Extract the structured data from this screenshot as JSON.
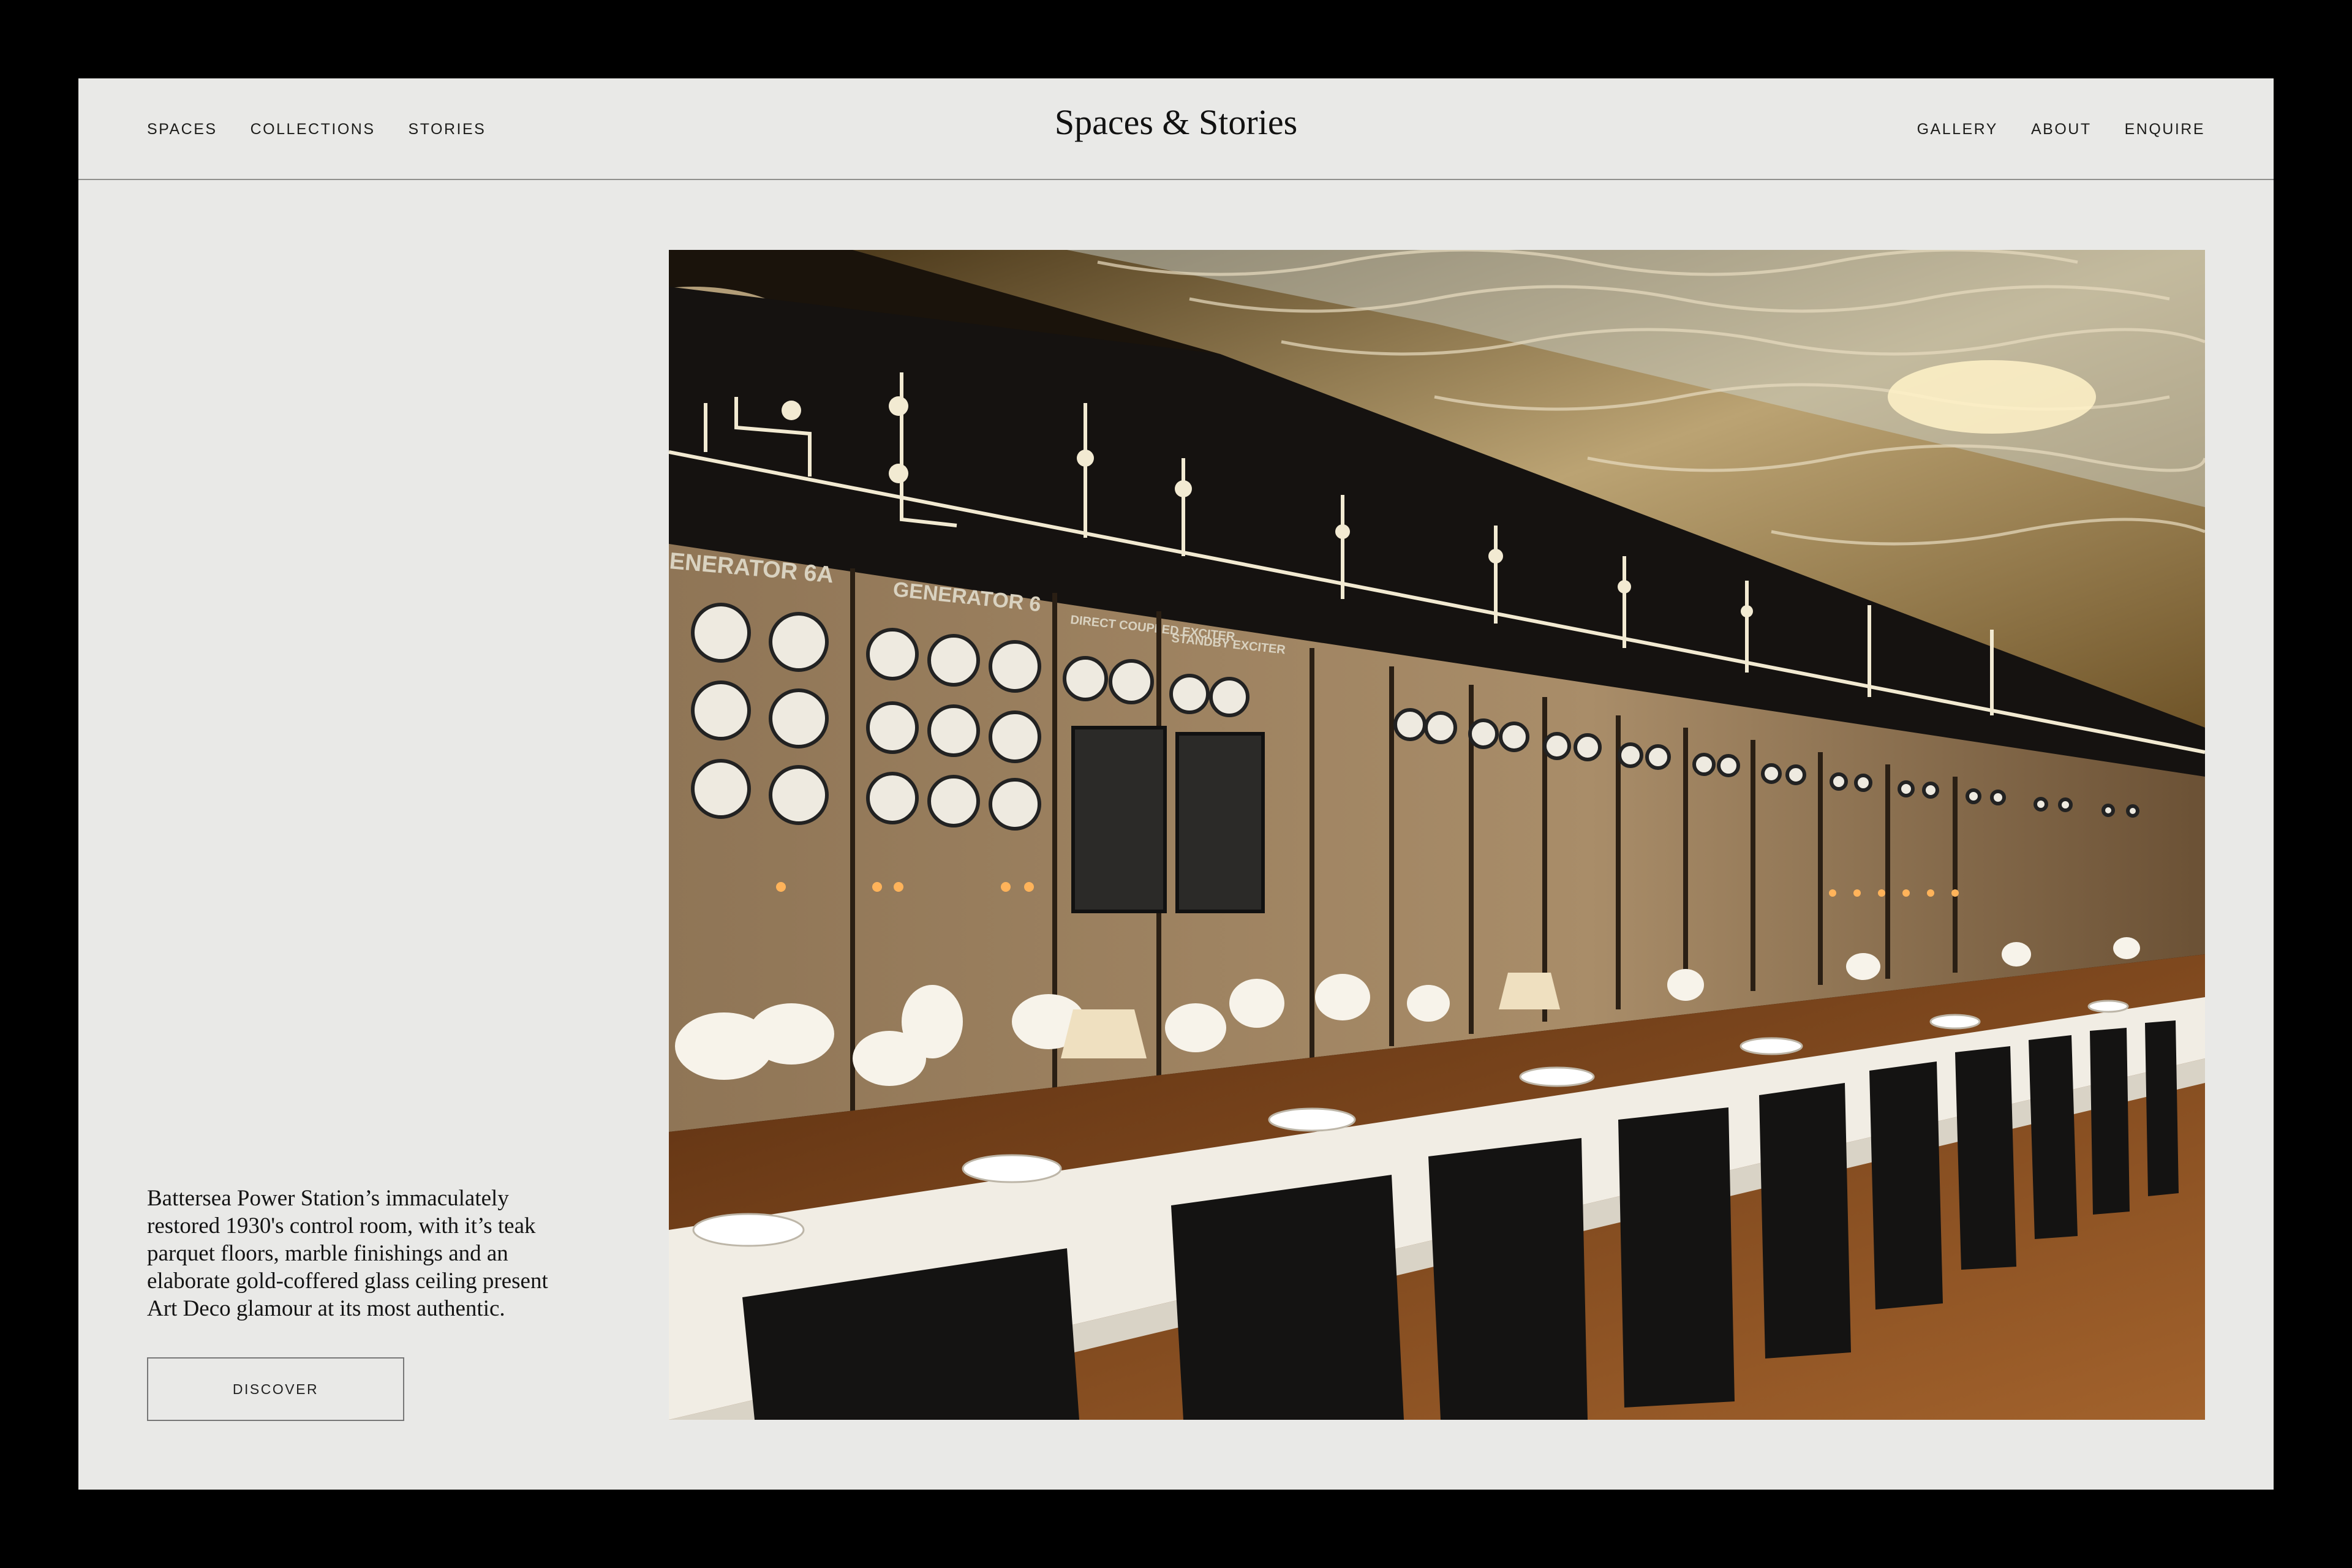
{
  "header": {
    "brand": "Spaces & Stories",
    "nav_left": [
      {
        "label": "SPACES"
      },
      {
        "label": "COLLECTIONS"
      },
      {
        "label": "STORIES"
      }
    ],
    "nav_right": [
      {
        "label": "GALLERY"
      },
      {
        "label": "ABOUT"
      },
      {
        "label": "ENQUIRE"
      }
    ]
  },
  "hero": {
    "panel_labels": [
      "ENERATOR 6A",
      "GENERATOR 6",
      "DIRECT COUPLED EXCITER",
      "STANDBY EXCITER"
    ]
  },
  "intro": {
    "lines": [
      "Battersea Power Station’s immaculately",
      "restored 1930's control room, with it’s teak",
      "parquet floors, marble finishings and an",
      "elaborate gold-coffered glass ceiling present",
      "Art Deco glamour at its most authentic."
    ],
    "cta_label": "DISCOVER"
  },
  "colors": {
    "page_background": "#e9e9e7",
    "outer_background": "#000000",
    "text": "#141414"
  }
}
